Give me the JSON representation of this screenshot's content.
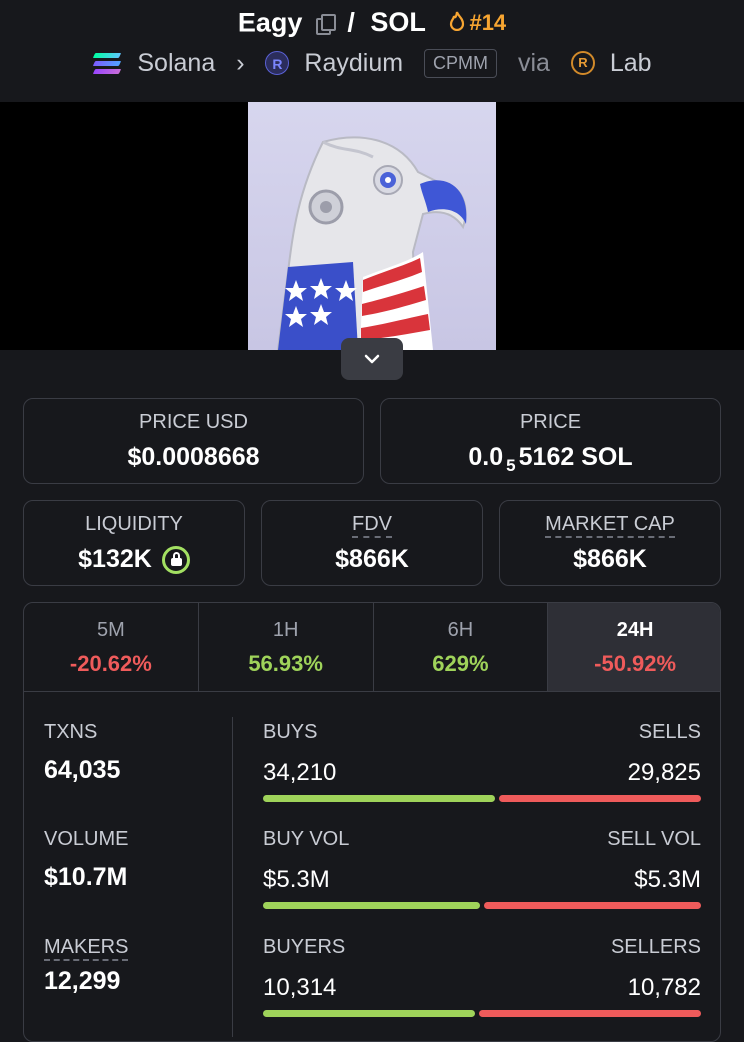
{
  "header": {
    "token_name": "Eagy",
    "separator": "/",
    "quote": "SOL",
    "rank": "#14",
    "chain": "Solana",
    "dex": "Raydium",
    "pool_type": "CPMM",
    "via": "via",
    "launchpad": "Lab"
  },
  "icons": {
    "copy": "copy-icon",
    "rank": "fire-icon",
    "chain": "solana-logo",
    "dex": "raydium-logo",
    "launchpad": "lab-logo",
    "expand": "chevron-down-icon",
    "liquidity_lock": "lock-icon"
  },
  "colors": {
    "accent_rank": "#f7a531",
    "positive": "#9fd35a",
    "negative": "#ef5b5b",
    "background": "#17181c"
  },
  "cards": {
    "price_usd": {
      "label": "PRICE USD",
      "value": "$0.0008668"
    },
    "price": {
      "label": "PRICE",
      "value_prefix": "0.0",
      "value_sub": "5",
      "value_suffix": "5162 SOL"
    },
    "liquidity": {
      "label": "LIQUIDITY",
      "value": "$132K"
    },
    "fdv": {
      "label": "FDV",
      "value": "$866K"
    },
    "market_cap": {
      "label": "MARKET CAP",
      "value": "$866K"
    }
  },
  "tabs": [
    {
      "label": "5M",
      "value": "-20.62%"
    },
    {
      "label": "1H",
      "value": "56.93%"
    },
    {
      "label": "6H",
      "value": "629%"
    },
    {
      "label": "24H",
      "value": "-50.92%"
    }
  ],
  "stats": {
    "txns": {
      "label": "TXNS",
      "value": "64,035"
    },
    "volume": {
      "label": "VOLUME",
      "value": "$10.7M"
    },
    "makers": {
      "label": "MAKERS",
      "value": "12,299"
    },
    "buys": {
      "label": "BUYS",
      "value": "34,210",
      "fraction": 0.534
    },
    "sells": {
      "label": "SELLS",
      "value": "29,825",
      "fraction": 0.466
    },
    "buy_vol": {
      "label": "BUY VOL",
      "value": "$5.3M",
      "fraction": 0.5
    },
    "sell_vol": {
      "label": "SELL VOL",
      "value": "$5.3M",
      "fraction": 0.5
    },
    "buyers": {
      "label": "BUYERS",
      "value": "10,314",
      "fraction": 0.489
    },
    "sellers": {
      "label": "SELLERS",
      "value": "10,782",
      "fraction": 0.511
    }
  }
}
